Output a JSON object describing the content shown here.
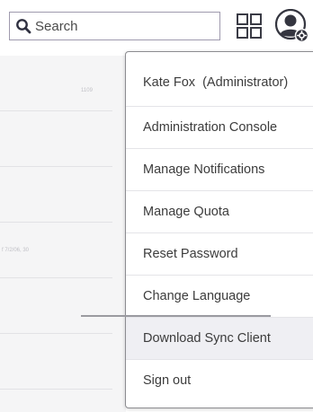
{
  "search": {
    "placeholder": "Search",
    "icon": "search-icon"
  },
  "header": {
    "apps_icon": "grid-apps-icon",
    "avatar_icon": "user-gear-icon"
  },
  "background_rows": {
    "row1_text": "1109",
    "row4_text": "f 7/2/06, 30"
  },
  "menu": {
    "user_name": "Kate Fox",
    "user_role": "(Administrator)",
    "items": [
      {
        "label": "Administration Console"
      },
      {
        "label": "Manage Notifications"
      },
      {
        "label": "Manage Quota"
      },
      {
        "label": "Reset Password"
      },
      {
        "label": "Change Language"
      },
      {
        "label": "Download Sync Client"
      },
      {
        "label": "Sign out"
      }
    ]
  },
  "colors": {
    "icon": "#3a3b45",
    "menu_border": "#8c8c90",
    "highlight": "#efeff3"
  }
}
